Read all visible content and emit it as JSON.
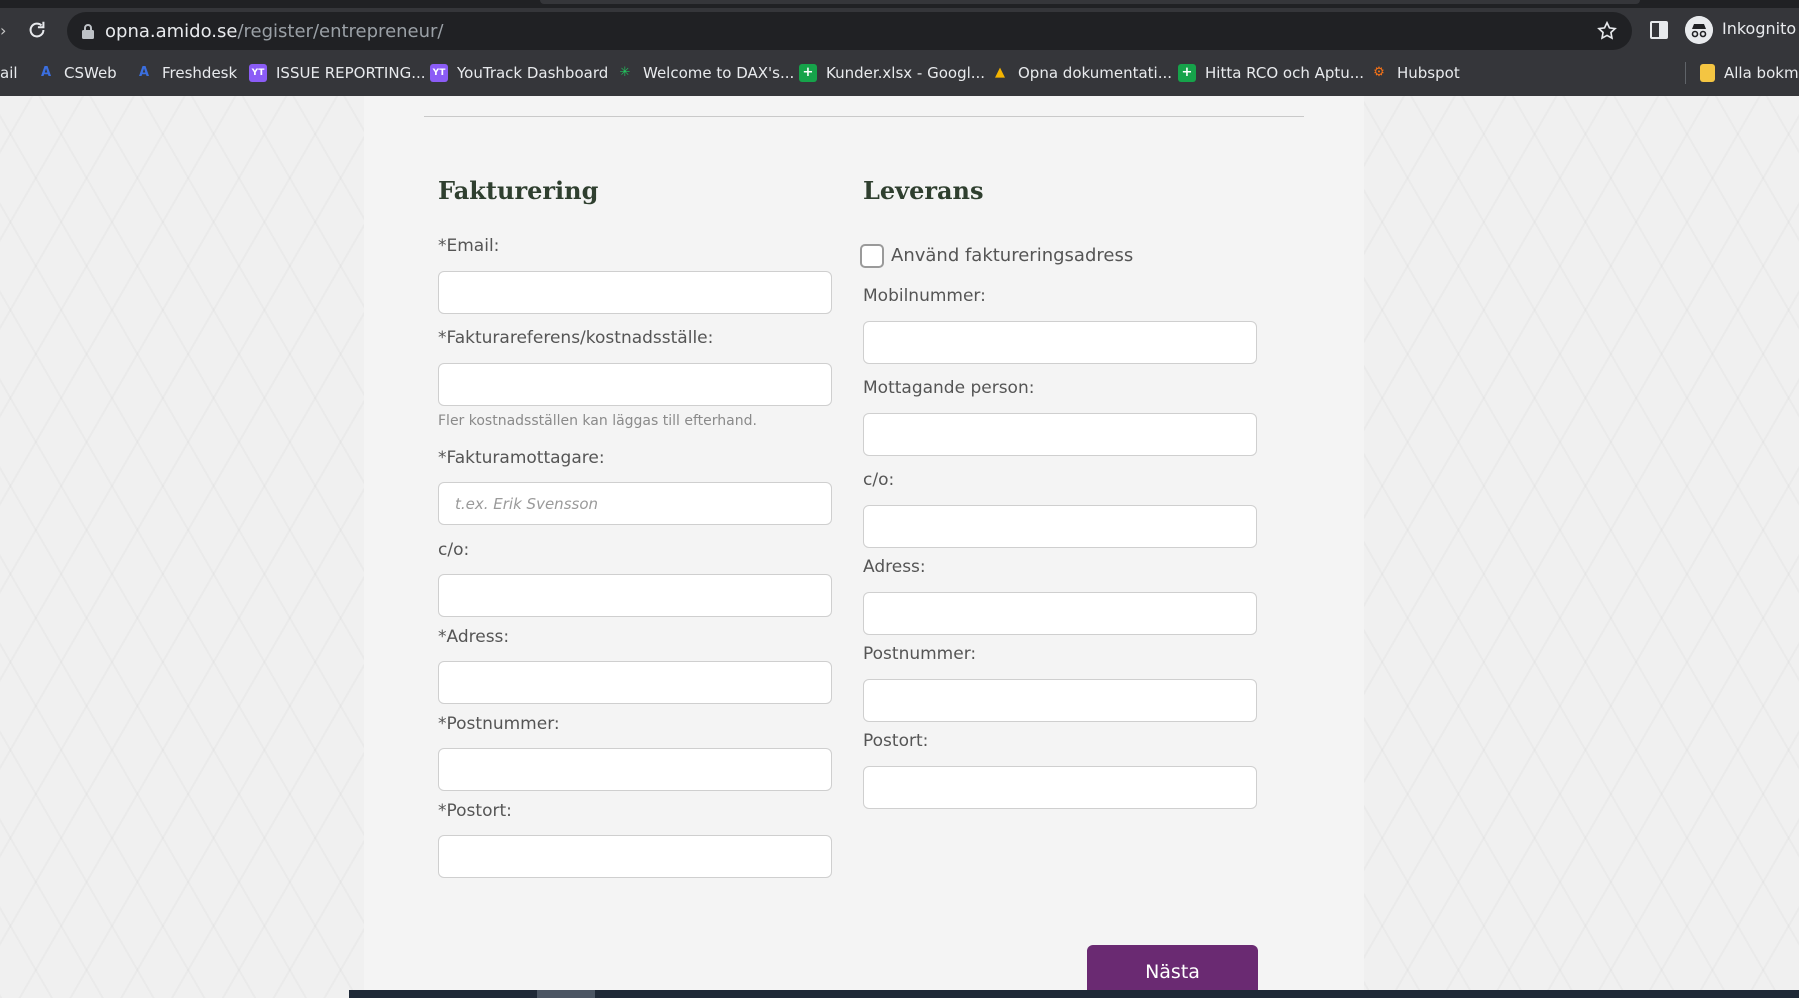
{
  "browser": {
    "nav_left_glyph": "›",
    "url_host": "opna.amido.se",
    "url_path": "/register/entrepreneur/",
    "profile_label": "Inkognito",
    "bookmarks": [
      {
        "label": "ail",
        "icon": "",
        "color": ""
      },
      {
        "label": "CSWeb",
        "icon": "A",
        "color": "#3b6fe0"
      },
      {
        "label": "Freshdesk",
        "icon": "A",
        "color": "#3b6fe0"
      },
      {
        "label": "ISSUE REPORTING...",
        "icon": "YT",
        "color": "#8b5cf6"
      },
      {
        "label": "YouTrack Dashboard",
        "icon": "YT",
        "color": "#8b5cf6"
      },
      {
        "label": "Welcome to DAX's...",
        "icon": "✳",
        "color": "#22c55e"
      },
      {
        "label": "Kunder.xlsx - Googl...",
        "icon": "+",
        "color": "#16a34a"
      },
      {
        "label": "Opna dokumentati...",
        "icon": "▲",
        "color": "#f4b400"
      },
      {
        "label": "Hitta RCO och Aptu...",
        "icon": "+",
        "color": "#16a34a"
      },
      {
        "label": "Hubspot",
        "icon": "⚙",
        "color": "#f97316"
      },
      {
        "label": "Alla bokmä",
        "icon": "",
        "color": "#f4c542"
      }
    ]
  },
  "billing": {
    "title": "Fakturering",
    "email_label": "*Email:",
    "email_value": "",
    "reference_label": "*Fakturareferens/kostnadsställe:",
    "reference_value": "",
    "reference_help": "Fler kostnadsställen kan läggas till efterhand.",
    "recipient_label": "*Fakturamottagare:",
    "recipient_placeholder": "t.ex. Erik Svensson",
    "recipient_value": "",
    "co_label": "c/o:",
    "co_value": "",
    "address_label": "*Adress:",
    "address_value": "",
    "postcode_label": "*Postnummer:",
    "postcode_value": "",
    "city_label": "*Postort:",
    "city_value": ""
  },
  "delivery": {
    "title": "Leverans",
    "use_billing_label": "Använd faktureringsadress",
    "use_billing_checked": false,
    "mobile_label": "Mobilnummer:",
    "mobile_value": "",
    "receiver_label": "Mottagande person:",
    "receiver_value": "",
    "co_label": "c/o:",
    "co_value": "",
    "address_label": "Adress:",
    "address_value": "",
    "postcode_label": "Postnummer:",
    "postcode_value": "",
    "city_label": "Postort:",
    "city_value": ""
  },
  "actions": {
    "next_label": "Nästa",
    "accent_color": "#6a2a72"
  }
}
